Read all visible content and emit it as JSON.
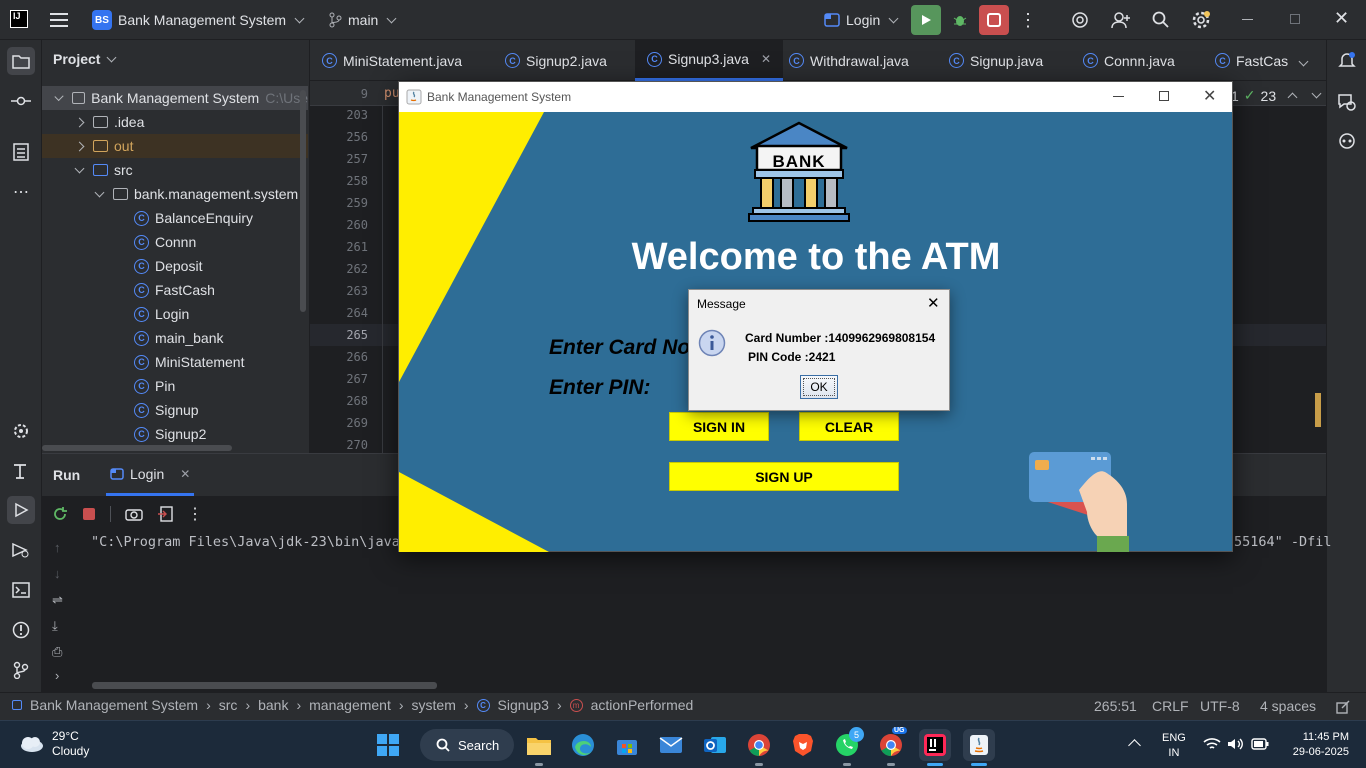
{
  "titlebar": {
    "project_badge": "BS",
    "project_name": "Bank Management System",
    "branch": "main",
    "run_config": "Login"
  },
  "project_panel": {
    "title": "Project",
    "root": "Bank Management System",
    "root_path": "C:\\Use",
    "folders": [
      ".idea",
      "out",
      "src"
    ],
    "package": "bank.management.system",
    "classes": [
      "BalanceEnquiry",
      "Connn",
      "Deposit",
      "FastCash",
      "Login",
      "main_bank",
      "MiniStatement",
      "Pin",
      "Signup",
      "Signup2"
    ]
  },
  "tabs": [
    "MiniStatement.java",
    "Signup2.java",
    "Signup3.java",
    "Withdrawal.java",
    "Signup.java",
    "Connn.java",
    "FastCas"
  ],
  "editor": {
    "line_numbers": [
      "9",
      "203",
      "256",
      "257",
      "258",
      "259",
      "260",
      "261",
      "262",
      "263",
      "264",
      "265",
      "266",
      "267",
      "268",
      "269",
      "270"
    ],
    "first_code": "pu",
    "inspection_warnings": "1",
    "inspection_ok": "23"
  },
  "run_panel": {
    "tab_run": "Run",
    "tab_config": "Login",
    "console_left": "\"C:\\Program Files\\Java\\jdk-23\\bin\\java",
    "console_right": "55164\" -Dfil"
  },
  "statusbar": {
    "crumbs": [
      "Bank Management System",
      "src",
      "bank",
      "management",
      "system",
      "Signup3",
      "actionPerformed"
    ],
    "position": "265:51",
    "line_sep": "CRLF",
    "encoding": "UTF-8",
    "indent": "4 spaces"
  },
  "swing": {
    "title": "Bank Management System",
    "logo_text": "BANK",
    "welcome": "Welcome to the ATM",
    "card_label": "Enter Card No:",
    "pin_label": "Enter PIN:",
    "sign_in": "SIGN IN",
    "clear": "CLEAR",
    "sign_up": "SIGN UP"
  },
  "dialog": {
    "title": "Message",
    "card_line": "Card Number :1409962969808154",
    "pin_line": "PIN Code :2421",
    "ok": "OK"
  },
  "taskbar": {
    "temperature": "29°C",
    "weather": "Cloudy",
    "search": "Search",
    "whatsapp_count": "5",
    "chrome_badge": "UG",
    "lang1": "ENG",
    "lang2": "IN",
    "time": "11:45 PM",
    "date": "29-06-2025"
  },
  "colors": {
    "ide_bg": "#1e1f22",
    "panel_bg": "#2b2d30",
    "accent": "#3574f0",
    "atm_blue": "#2e6d96",
    "atm_yellow": "#ffff00"
  }
}
